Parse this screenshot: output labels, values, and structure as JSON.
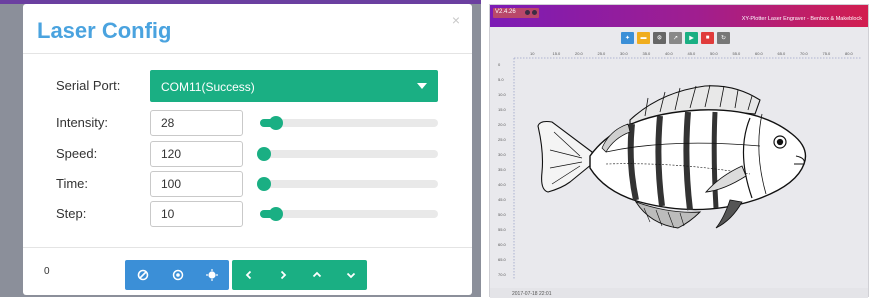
{
  "laser_config": {
    "title": "Laser Config",
    "close_glyph": "×",
    "serial_port": {
      "label": "Serial Port:",
      "value": "COM11(Success)"
    },
    "fields": [
      {
        "key": "intensity",
        "label": "Intensity:",
        "value": "28",
        "slider_fraction": 0.09
      },
      {
        "key": "speed",
        "label": "Speed:",
        "value": "120",
        "slider_fraction": 0.02
      },
      {
        "key": "time",
        "label": "Time:",
        "value": "100",
        "slider_fraction": 0.02
      },
      {
        "key": "step",
        "label": "Step:",
        "value": "10",
        "slider_fraction": 0.09
      }
    ],
    "footer": {
      "counter": "0",
      "blue_buttons": [
        "block-icon",
        "target-icon",
        "sun-icon"
      ],
      "green_buttons": [
        "chevron-left-icon",
        "chevron-right-icon",
        "chevron-up-icon",
        "chevron-down-icon"
      ]
    },
    "colors": {
      "title": "#4aa3df",
      "accent_green": "#1aaf83",
      "accent_blue": "#3b8fd7"
    }
  },
  "plotter_app": {
    "version": "V2.4.26",
    "title": "XY-Plotter Laser Engraver - Benbox & Makeblock",
    "toolbar": [
      {
        "icon": "crosshair-icon",
        "color": "#3b8fd7"
      },
      {
        "icon": "folder-icon",
        "color": "#f0ad1e"
      },
      {
        "icon": "settings-icon",
        "color": "#666666"
      },
      {
        "icon": "link-icon",
        "color": "#888888"
      },
      {
        "icon": "play-icon",
        "color": "#1aaf83"
      },
      {
        "icon": "stop-icon",
        "color": "#e03b3b"
      },
      {
        "icon": "refresh-icon",
        "color": "#777777"
      }
    ],
    "x_ticks": [
      "10",
      "15.0",
      "20.0",
      "25.0",
      "30.0",
      "35.0",
      "40.0",
      "45.0",
      "50.0",
      "55.0",
      "60.0",
      "65.0",
      "70.0",
      "75.0",
      "80.0"
    ],
    "y_ticks": [
      "0",
      "5.0",
      "10.0",
      "15.0",
      "20.0",
      "25.0",
      "30.0",
      "35.0",
      "40.0",
      "45.0",
      "50.0",
      "55.0",
      "60.0",
      "65.0",
      "70.0"
    ],
    "status": "2017-07-18 22:01",
    "colors": {
      "titlebar_start": "#7c1bb5",
      "titlebar_end": "#d21e4f"
    }
  }
}
